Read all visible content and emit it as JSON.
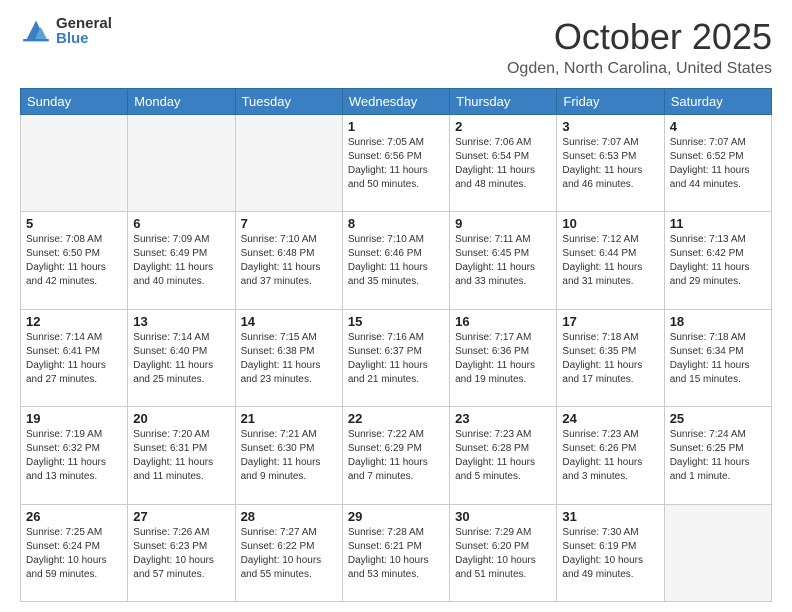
{
  "logo": {
    "general": "General",
    "blue": "Blue"
  },
  "title": "October 2025",
  "location": "Ogden, North Carolina, United States",
  "headers": [
    "Sunday",
    "Monday",
    "Tuesday",
    "Wednesday",
    "Thursday",
    "Friday",
    "Saturday"
  ],
  "weeks": [
    [
      {
        "day": "",
        "info": ""
      },
      {
        "day": "",
        "info": ""
      },
      {
        "day": "",
        "info": ""
      },
      {
        "day": "1",
        "info": "Sunrise: 7:05 AM\nSunset: 6:56 PM\nDaylight: 11 hours\nand 50 minutes."
      },
      {
        "day": "2",
        "info": "Sunrise: 7:06 AM\nSunset: 6:54 PM\nDaylight: 11 hours\nand 48 minutes."
      },
      {
        "day": "3",
        "info": "Sunrise: 7:07 AM\nSunset: 6:53 PM\nDaylight: 11 hours\nand 46 minutes."
      },
      {
        "day": "4",
        "info": "Sunrise: 7:07 AM\nSunset: 6:52 PM\nDaylight: 11 hours\nand 44 minutes."
      }
    ],
    [
      {
        "day": "5",
        "info": "Sunrise: 7:08 AM\nSunset: 6:50 PM\nDaylight: 11 hours\nand 42 minutes."
      },
      {
        "day": "6",
        "info": "Sunrise: 7:09 AM\nSunset: 6:49 PM\nDaylight: 11 hours\nand 40 minutes."
      },
      {
        "day": "7",
        "info": "Sunrise: 7:10 AM\nSunset: 6:48 PM\nDaylight: 11 hours\nand 37 minutes."
      },
      {
        "day": "8",
        "info": "Sunrise: 7:10 AM\nSunset: 6:46 PM\nDaylight: 11 hours\nand 35 minutes."
      },
      {
        "day": "9",
        "info": "Sunrise: 7:11 AM\nSunset: 6:45 PM\nDaylight: 11 hours\nand 33 minutes."
      },
      {
        "day": "10",
        "info": "Sunrise: 7:12 AM\nSunset: 6:44 PM\nDaylight: 11 hours\nand 31 minutes."
      },
      {
        "day": "11",
        "info": "Sunrise: 7:13 AM\nSunset: 6:42 PM\nDaylight: 11 hours\nand 29 minutes."
      }
    ],
    [
      {
        "day": "12",
        "info": "Sunrise: 7:14 AM\nSunset: 6:41 PM\nDaylight: 11 hours\nand 27 minutes."
      },
      {
        "day": "13",
        "info": "Sunrise: 7:14 AM\nSunset: 6:40 PM\nDaylight: 11 hours\nand 25 minutes."
      },
      {
        "day": "14",
        "info": "Sunrise: 7:15 AM\nSunset: 6:38 PM\nDaylight: 11 hours\nand 23 minutes."
      },
      {
        "day": "15",
        "info": "Sunrise: 7:16 AM\nSunset: 6:37 PM\nDaylight: 11 hours\nand 21 minutes."
      },
      {
        "day": "16",
        "info": "Sunrise: 7:17 AM\nSunset: 6:36 PM\nDaylight: 11 hours\nand 19 minutes."
      },
      {
        "day": "17",
        "info": "Sunrise: 7:18 AM\nSunset: 6:35 PM\nDaylight: 11 hours\nand 17 minutes."
      },
      {
        "day": "18",
        "info": "Sunrise: 7:18 AM\nSunset: 6:34 PM\nDaylight: 11 hours\nand 15 minutes."
      }
    ],
    [
      {
        "day": "19",
        "info": "Sunrise: 7:19 AM\nSunset: 6:32 PM\nDaylight: 11 hours\nand 13 minutes."
      },
      {
        "day": "20",
        "info": "Sunrise: 7:20 AM\nSunset: 6:31 PM\nDaylight: 11 hours\nand 11 minutes."
      },
      {
        "day": "21",
        "info": "Sunrise: 7:21 AM\nSunset: 6:30 PM\nDaylight: 11 hours\nand 9 minutes."
      },
      {
        "day": "22",
        "info": "Sunrise: 7:22 AM\nSunset: 6:29 PM\nDaylight: 11 hours\nand 7 minutes."
      },
      {
        "day": "23",
        "info": "Sunrise: 7:23 AM\nSunset: 6:28 PM\nDaylight: 11 hours\nand 5 minutes."
      },
      {
        "day": "24",
        "info": "Sunrise: 7:23 AM\nSunset: 6:26 PM\nDaylight: 11 hours\nand 3 minutes."
      },
      {
        "day": "25",
        "info": "Sunrise: 7:24 AM\nSunset: 6:25 PM\nDaylight: 11 hours\nand 1 minute."
      }
    ],
    [
      {
        "day": "26",
        "info": "Sunrise: 7:25 AM\nSunset: 6:24 PM\nDaylight: 10 hours\nand 59 minutes."
      },
      {
        "day": "27",
        "info": "Sunrise: 7:26 AM\nSunset: 6:23 PM\nDaylight: 10 hours\nand 57 minutes."
      },
      {
        "day": "28",
        "info": "Sunrise: 7:27 AM\nSunset: 6:22 PM\nDaylight: 10 hours\nand 55 minutes."
      },
      {
        "day": "29",
        "info": "Sunrise: 7:28 AM\nSunset: 6:21 PM\nDaylight: 10 hours\nand 53 minutes."
      },
      {
        "day": "30",
        "info": "Sunrise: 7:29 AM\nSunset: 6:20 PM\nDaylight: 10 hours\nand 51 minutes."
      },
      {
        "day": "31",
        "info": "Sunrise: 7:30 AM\nSunset: 6:19 PM\nDaylight: 10 hours\nand 49 minutes."
      },
      {
        "day": "",
        "info": ""
      }
    ]
  ]
}
